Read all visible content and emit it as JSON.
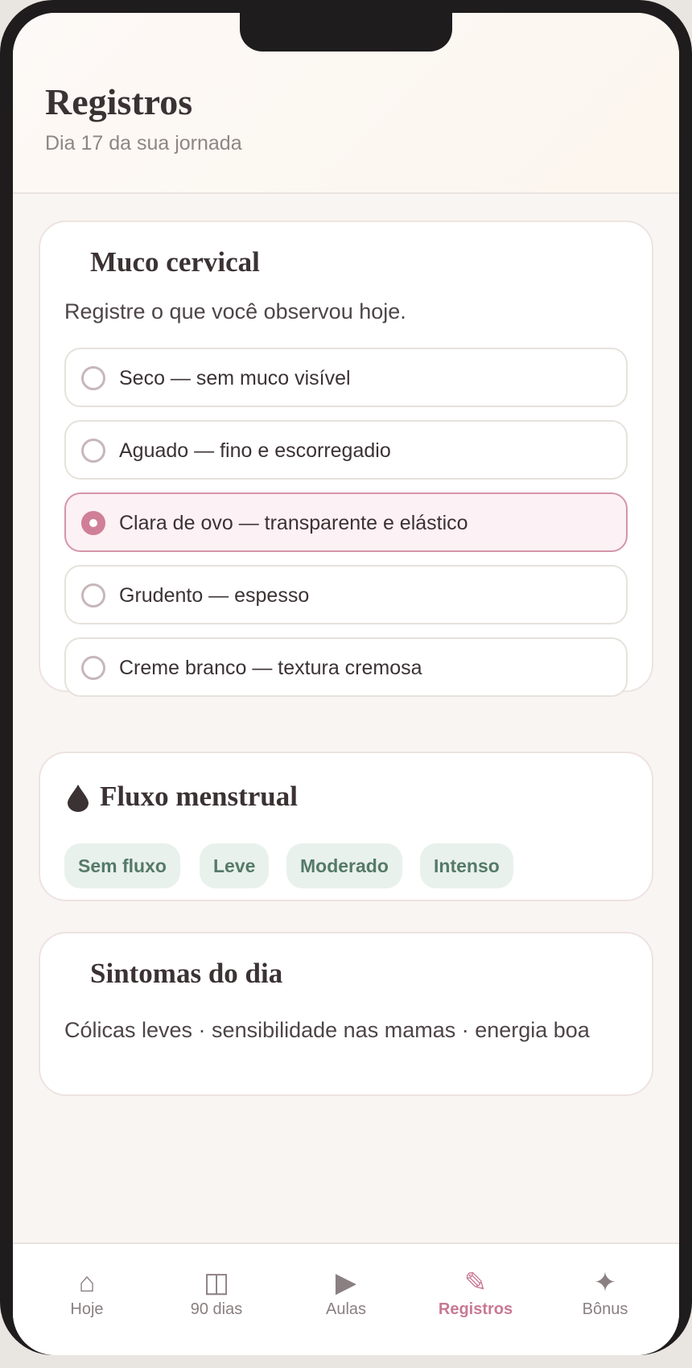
{
  "header": {
    "title": "Registros",
    "subtitle": "Dia 17 da sua jornada"
  },
  "mucus": {
    "title": "Muco cervical",
    "description": "Registre o que você observou hoje.",
    "options": [
      {
        "label": "Seco — sem muco visível",
        "selected": false
      },
      {
        "label": "Aguado — fino e escorregadio",
        "selected": false
      },
      {
        "label": "Clara de ovo — transparente e elástico",
        "selected": true
      },
      {
        "label": "Grudento — espesso",
        "selected": false
      },
      {
        "label": "Creme branco — textura cremosa",
        "selected": false
      }
    ]
  },
  "flow": {
    "title": "Fluxo menstrual",
    "icon": "drop-icon",
    "chips": [
      "Sem fluxo",
      "Leve",
      "Moderado",
      "Intenso"
    ]
  },
  "symptoms": {
    "title": "Sintomas do dia",
    "text": "Cólicas leves · sensibilidade nas mamas · energia boa"
  },
  "nav": {
    "items": [
      {
        "label": "Hoje",
        "icon": "home-icon",
        "glyph": "⌂",
        "active": false
      },
      {
        "label": "90 dias",
        "icon": "calendar-icon",
        "glyph": "◫",
        "active": false
      },
      {
        "label": "Aulas",
        "icon": "play-icon",
        "glyph": "▶",
        "active": false
      },
      {
        "label": "Registros",
        "icon": "pencil-icon",
        "glyph": "✎",
        "active": true
      },
      {
        "label": "Bônus",
        "icon": "sparkle-icon",
        "glyph": "✦",
        "active": false
      }
    ]
  },
  "colors": {
    "accent": "#c97993",
    "chip_bg": "#e9f1ec",
    "chip_text": "#557a68",
    "title_text": "#3b3234"
  }
}
